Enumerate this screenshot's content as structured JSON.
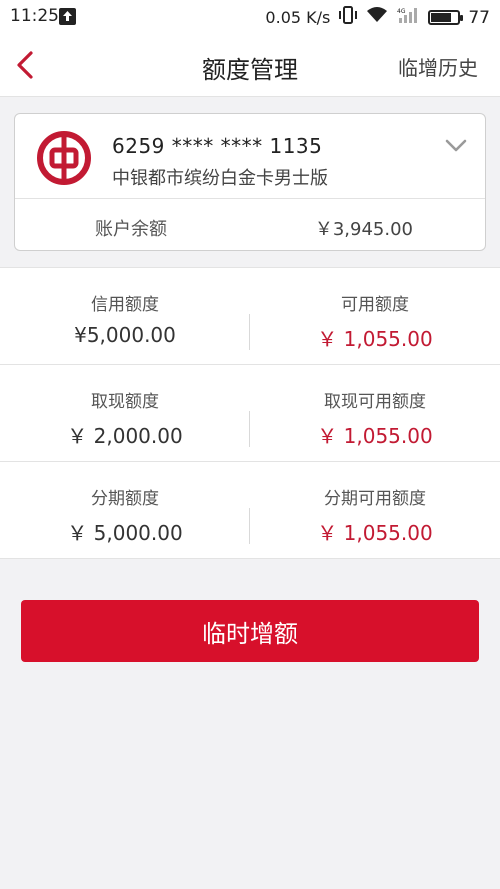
{
  "status_bar": {
    "time": "11:25",
    "net_speed": "0.05 K/s",
    "battery": "77",
    "battery_level": 0.77
  },
  "nav": {
    "title": "额度管理",
    "history_label": "临增历史",
    "back_icon": "chevron-left-icon"
  },
  "card": {
    "number": "6259 **** **** 1135",
    "name": "中银都市缤纷白金卡男士版",
    "balance_label": "账户余额",
    "balance_value": "￥3,945.00"
  },
  "limits": [
    {
      "left_label": "信用额度",
      "left_value": "¥5,000.00",
      "right_label": "可用额度",
      "right_value": "￥ 1,055.00"
    },
    {
      "left_label": "取现额度",
      "left_value": "￥ 2,000.00",
      "right_label": "取现可用额度",
      "right_value": "￥ 1,055.00"
    },
    {
      "left_label": "分期额度",
      "left_value": "￥ 5,000.00",
      "right_label": "分期可用额度",
      "right_value": "￥ 1,055.00"
    }
  ],
  "action": {
    "temp_increase_label": "临时增额"
  },
  "colors": {
    "brand_red": "#d7102b",
    "accent_red_text": "#c21a33",
    "background": "#f2f2f4"
  }
}
